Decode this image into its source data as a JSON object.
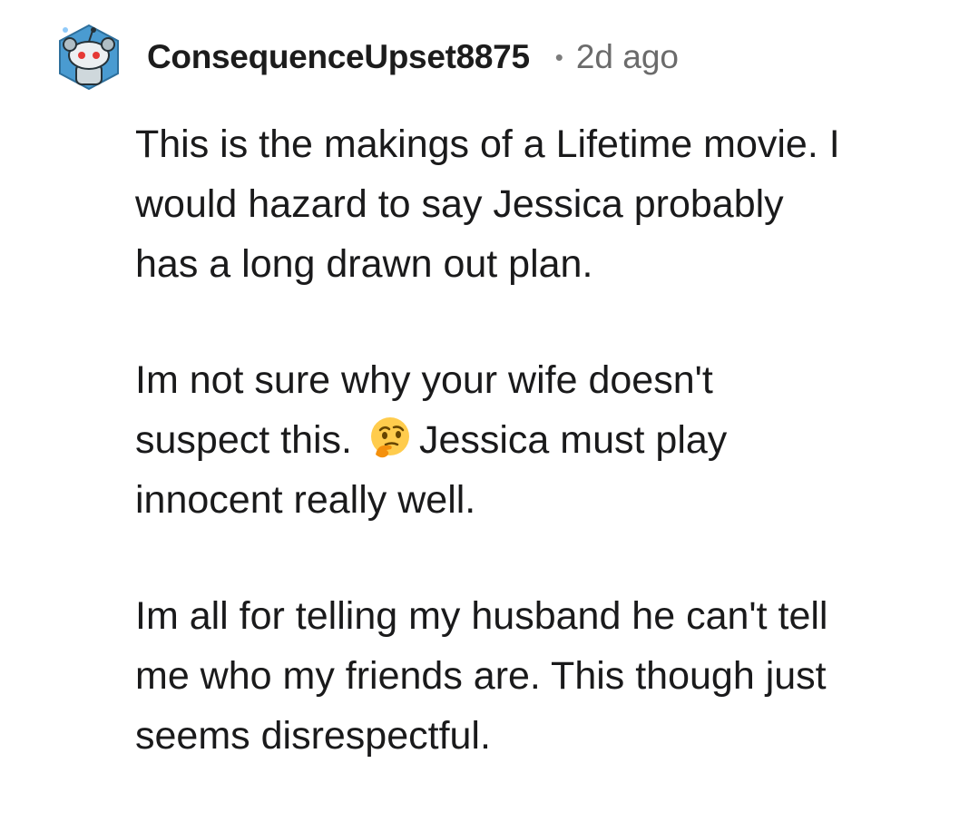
{
  "comment": {
    "username": "ConsequenceUpset8875",
    "separator": "•",
    "timestamp": "2d ago",
    "avatar_icon": "snoo-avatar-icon",
    "paragraphs": [
      {
        "lines": [
          "This is the makings of a Lifetime movie. I",
          "would hazard to say Jessica probably",
          "has a long drawn out plan."
        ]
      },
      {
        "line1": "Im not sure why your wife doesn't",
        "line2_before": "suspect this.",
        "line2_emoji": "thinking-face-emoji",
        "line2_after": "Jessica must play",
        "line3": "innocent really well."
      },
      {
        "lines": [
          "Im all for telling my husband he can't tell",
          "me who my friends are. This though just",
          "seems disrespectful."
        ]
      }
    ]
  },
  "colors": {
    "text": "#1a1a1b",
    "username": "#1c1c1c",
    "meta": "#6b6b6b",
    "avatar_bg": "#4a9bd1",
    "emoji": "#ffcc4d"
  }
}
